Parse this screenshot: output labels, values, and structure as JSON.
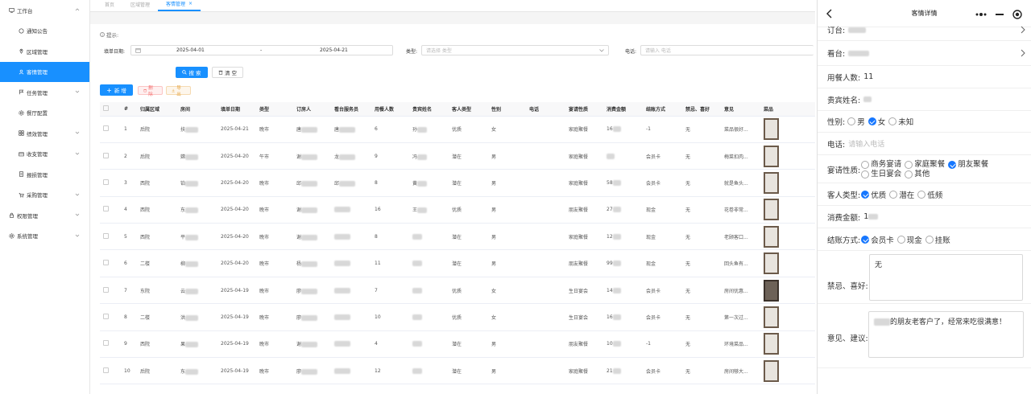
{
  "sidebar": {
    "items": [
      {
        "label": "工作台",
        "icon": "monitor-icon",
        "level": 1,
        "expanded": true
      },
      {
        "label": "通知公告",
        "icon": "message-icon",
        "level": 2
      },
      {
        "label": "区域管理",
        "icon": "location-icon",
        "level": 2
      },
      {
        "label": "客情管理",
        "icon": "user-icon",
        "level": 2,
        "active": true
      },
      {
        "label": "任务管理",
        "icon": "flag-icon",
        "level": 2,
        "expandable": true
      },
      {
        "label": "餐厅配置",
        "icon": "gear-icon",
        "level": 2
      },
      {
        "label": "绩效管理",
        "icon": "grid-icon",
        "level": 2,
        "expandable": true
      },
      {
        "label": "收支管理",
        "icon": "wallet-icon",
        "level": 2,
        "expandable": true
      },
      {
        "label": "报损管理",
        "icon": "doc-icon",
        "level": 2
      },
      {
        "label": "采购管理",
        "icon": "cart-icon",
        "level": 2,
        "expandable": true
      },
      {
        "label": "权限管理",
        "icon": "lock-icon",
        "level": 1,
        "expandable": true
      },
      {
        "label": "系统管理",
        "icon": "gear-icon",
        "level": 1,
        "expandable": true
      }
    ]
  },
  "tabs": [
    {
      "label": "首页",
      "active": false
    },
    {
      "label": "区域管理",
      "active": false
    },
    {
      "label": "客情管理",
      "active": true,
      "close": "×"
    }
  ],
  "hint": "提示:",
  "filters": {
    "date_label": "填单日期:",
    "date_start": "2025-04-01",
    "date_sep": "-",
    "date_end": "2025-04-21",
    "type_label": "类型:",
    "type_placeholder": "请选择 类型",
    "phone_label": "电话:",
    "phone_placeholder": "请输入 电话",
    "search_label": "搜 索",
    "clear_label": "清 空"
  },
  "actions": {
    "add_label": "新 增",
    "delete_label": "删 除",
    "export_label": "导 出"
  },
  "table": {
    "headers": [
      "",
      "#",
      "归属区域",
      "房间",
      "填单日期",
      "类型",
      "订房人",
      "看台服务员",
      "用餐人数",
      "贵宾姓名",
      "客人类型",
      "性别",
      "电话",
      "宴请性质",
      "消费金额",
      "结账方式",
      "禁忌、喜好",
      "意见",
      "菜品"
    ],
    "rows": [
      {
        "no": "1",
        "area": "后院",
        "room": "扶",
        "date": "2025-04-21",
        "type": "晚市",
        "booker": "唐",
        "waiter": "唐",
        "count": "6",
        "guest": "孙",
        "gtype": "优质",
        "gender": "女",
        "phone": "",
        "nature": "家庭聚餐",
        "amount": "16",
        "pay": "-1",
        "taboo": "无",
        "opinion": "菜品很好...",
        "dark": false
      },
      {
        "no": "2",
        "area": "后院",
        "room": "嫦",
        "date": "2025-04-20",
        "type": "午市",
        "booker": "谢",
        "waiter": "龙",
        "count": "9",
        "guest": "冯",
        "gtype": "潜在",
        "gender": "男",
        "phone": "",
        "nature": "家庭聚餐",
        "amount": "",
        "pay": "会员卡",
        "taboo": "无",
        "opinion": "梅菜扣肉...",
        "dark": false
      },
      {
        "no": "3",
        "area": "西院",
        "room": "铂",
        "date": "2025-04-20",
        "type": "晚市",
        "booker": "邱",
        "waiter": "邱",
        "count": "8",
        "guest": "黄",
        "gtype": "潜在",
        "gender": "男",
        "phone": "",
        "nature": "家庭聚餐",
        "amount": "58",
        "pay": "会员卡",
        "taboo": "无",
        "opinion": "就是鱼头...",
        "dark": false
      },
      {
        "no": "4",
        "area": "西院",
        "room": "东",
        "date": "2025-04-20",
        "type": "晚市",
        "booker": "谢",
        "waiter": "",
        "count": "16",
        "guest": "王",
        "gtype": "优质",
        "gender": "男",
        "phone": "",
        "nature": "朋友聚餐",
        "amount": "27",
        "pay": "现金",
        "taboo": "无",
        "opinion": "花卷非常...",
        "dark": false
      },
      {
        "no": "5",
        "area": "西院",
        "room": "平",
        "date": "2025-04-20",
        "type": "晚市",
        "booker": "谢",
        "waiter": "",
        "count": "8",
        "guest": "",
        "gtype": "潜在",
        "gender": "男",
        "phone": "",
        "nature": "家庭聚餐",
        "amount": "12",
        "pay": "现金",
        "taboo": "无",
        "opinion": "老顾客口...",
        "dark": false
      },
      {
        "no": "6",
        "area": "二楼",
        "room": "柳",
        "date": "2025-04-20",
        "type": "晚市",
        "booker": "杨",
        "waiter": "",
        "count": "11",
        "guest": "",
        "gtype": "潜在",
        "gender": "男",
        "phone": "",
        "nature": "朋友聚餐",
        "amount": "99",
        "pay": "现金",
        "taboo": "无",
        "opinion": "回头鱼有...",
        "dark": false
      },
      {
        "no": "7",
        "area": "东院",
        "room": "云",
        "date": "2025-04-19",
        "type": "晚市",
        "booker": "廖",
        "waiter": "",
        "count": "7",
        "guest": "",
        "gtype": "优质",
        "gender": "女",
        "phone": "",
        "nature": "生日宴会",
        "amount": "14",
        "pay": "会员卡",
        "taboo": "无",
        "opinion": "房间优惠...",
        "dark": true
      },
      {
        "no": "8",
        "area": "二楼",
        "room": "洪",
        "date": "2025-04-19",
        "type": "晚市",
        "booker": "廖",
        "waiter": "",
        "count": "10",
        "guest": "",
        "gtype": "优质",
        "gender": "女",
        "phone": "",
        "nature": "生日宴会",
        "amount": "16",
        "pay": "会员卡",
        "taboo": "无",
        "opinion": "第一次过...",
        "dark": false
      },
      {
        "no": "9",
        "area": "西院",
        "room": "果",
        "date": "2025-04-19",
        "type": "晚市",
        "booker": "谢",
        "waiter": "",
        "count": "4",
        "guest": "",
        "gtype": "潜在",
        "gender": "男",
        "phone": "",
        "nature": "朋友聚餐",
        "amount": "10",
        "pay": "-1",
        "taboo": "无",
        "opinion": "环境菜品...",
        "dark": false
      },
      {
        "no": "10",
        "area": "后院",
        "room": "东",
        "date": "2025-04-19",
        "type": "晚市",
        "booker": "廖",
        "waiter": "",
        "count": "12",
        "guest": "",
        "gtype": "潜在",
        "gender": "男",
        "phone": "",
        "nature": "家庭聚餐",
        "amount": "21",
        "pay": "会员卡",
        "taboo": "无",
        "opinion": "房间够大...",
        "dark": false
      }
    ]
  },
  "detail": {
    "title": "客情详情",
    "order_label": "订台:",
    "order_value": "",
    "watch_label": "看台:",
    "watch_value": "",
    "people_label": "用餐人数:",
    "people_value": "11",
    "guest_label": "贵宾姓名:",
    "guest_value": "",
    "gender_label": "性别:",
    "gender_options": [
      {
        "label": "男",
        "on": false
      },
      {
        "label": "女",
        "on": true
      },
      {
        "label": "未知",
        "on": false
      }
    ],
    "phone_label": "电话:",
    "phone_placeholder": "请输入电话",
    "nature_label": "宴请性质:",
    "nature_options": [
      {
        "label": "商务宴请",
        "on": false
      },
      {
        "label": "家庭聚餐",
        "on": false
      },
      {
        "label": "朋友聚餐",
        "on": true
      },
      {
        "label": "生日宴会",
        "on": false
      },
      {
        "label": "其他",
        "on": false
      }
    ],
    "gtype_label": "客人类型:",
    "gtype_options": [
      {
        "label": "优质",
        "on": true
      },
      {
        "label": "潜在",
        "on": false
      },
      {
        "label": "低频",
        "on": false
      }
    ],
    "amount_label": "消费金额:",
    "amount_value": "1",
    "pay_label": "结账方式:",
    "pay_options": [
      {
        "label": "会员卡",
        "on": true
      },
      {
        "label": "现金",
        "on": false
      },
      {
        "label": "挂账",
        "on": false
      }
    ],
    "taboo_label": "禁忌、喜好:",
    "taboo_value": "无",
    "opinion_label": "意见、建议:",
    "opinion_value": "的朋友老客户了，经常来吃很满意！"
  },
  "colors": {
    "primary": "#1890ff",
    "active_check": "#1677ff"
  }
}
